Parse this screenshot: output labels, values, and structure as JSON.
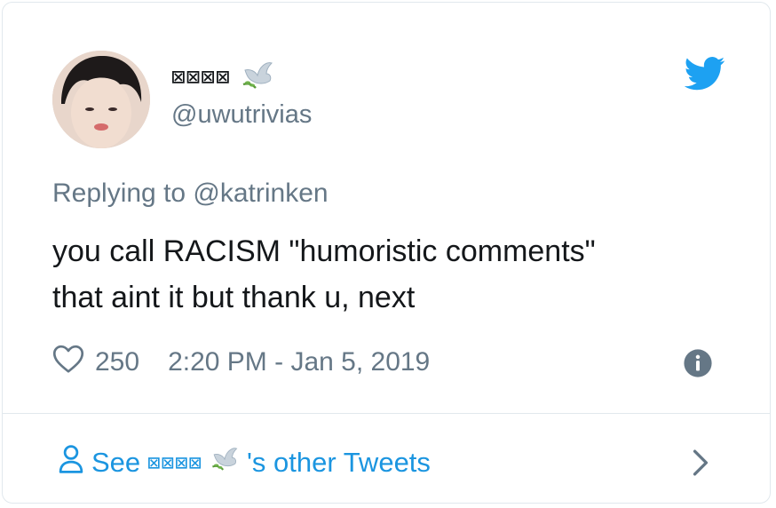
{
  "tweet": {
    "display_name": "⊠⊠⊠⊠",
    "handle": "@uwutrivias",
    "replying_to": "Replying to @katrinken",
    "text_lines": [
      "you call RACISM \"humoristic comments\"",
      "that aint it but thank u, next"
    ],
    "likes": "250",
    "timestamp": "2:20 PM - Jan 5, 2019"
  },
  "footer": {
    "prefix": "See",
    "name": "⊠⊠⊠⊠",
    "suffix": "'s other Tweets"
  },
  "colors": {
    "brand": "#1da1f2",
    "link": "#1b95e0",
    "muted": "#657786",
    "text": "#14171a"
  },
  "icons": [
    "dove-emoji-icon",
    "twitter-bird-icon",
    "heart-icon",
    "info-icon",
    "person-icon",
    "chevron-right-icon"
  ]
}
